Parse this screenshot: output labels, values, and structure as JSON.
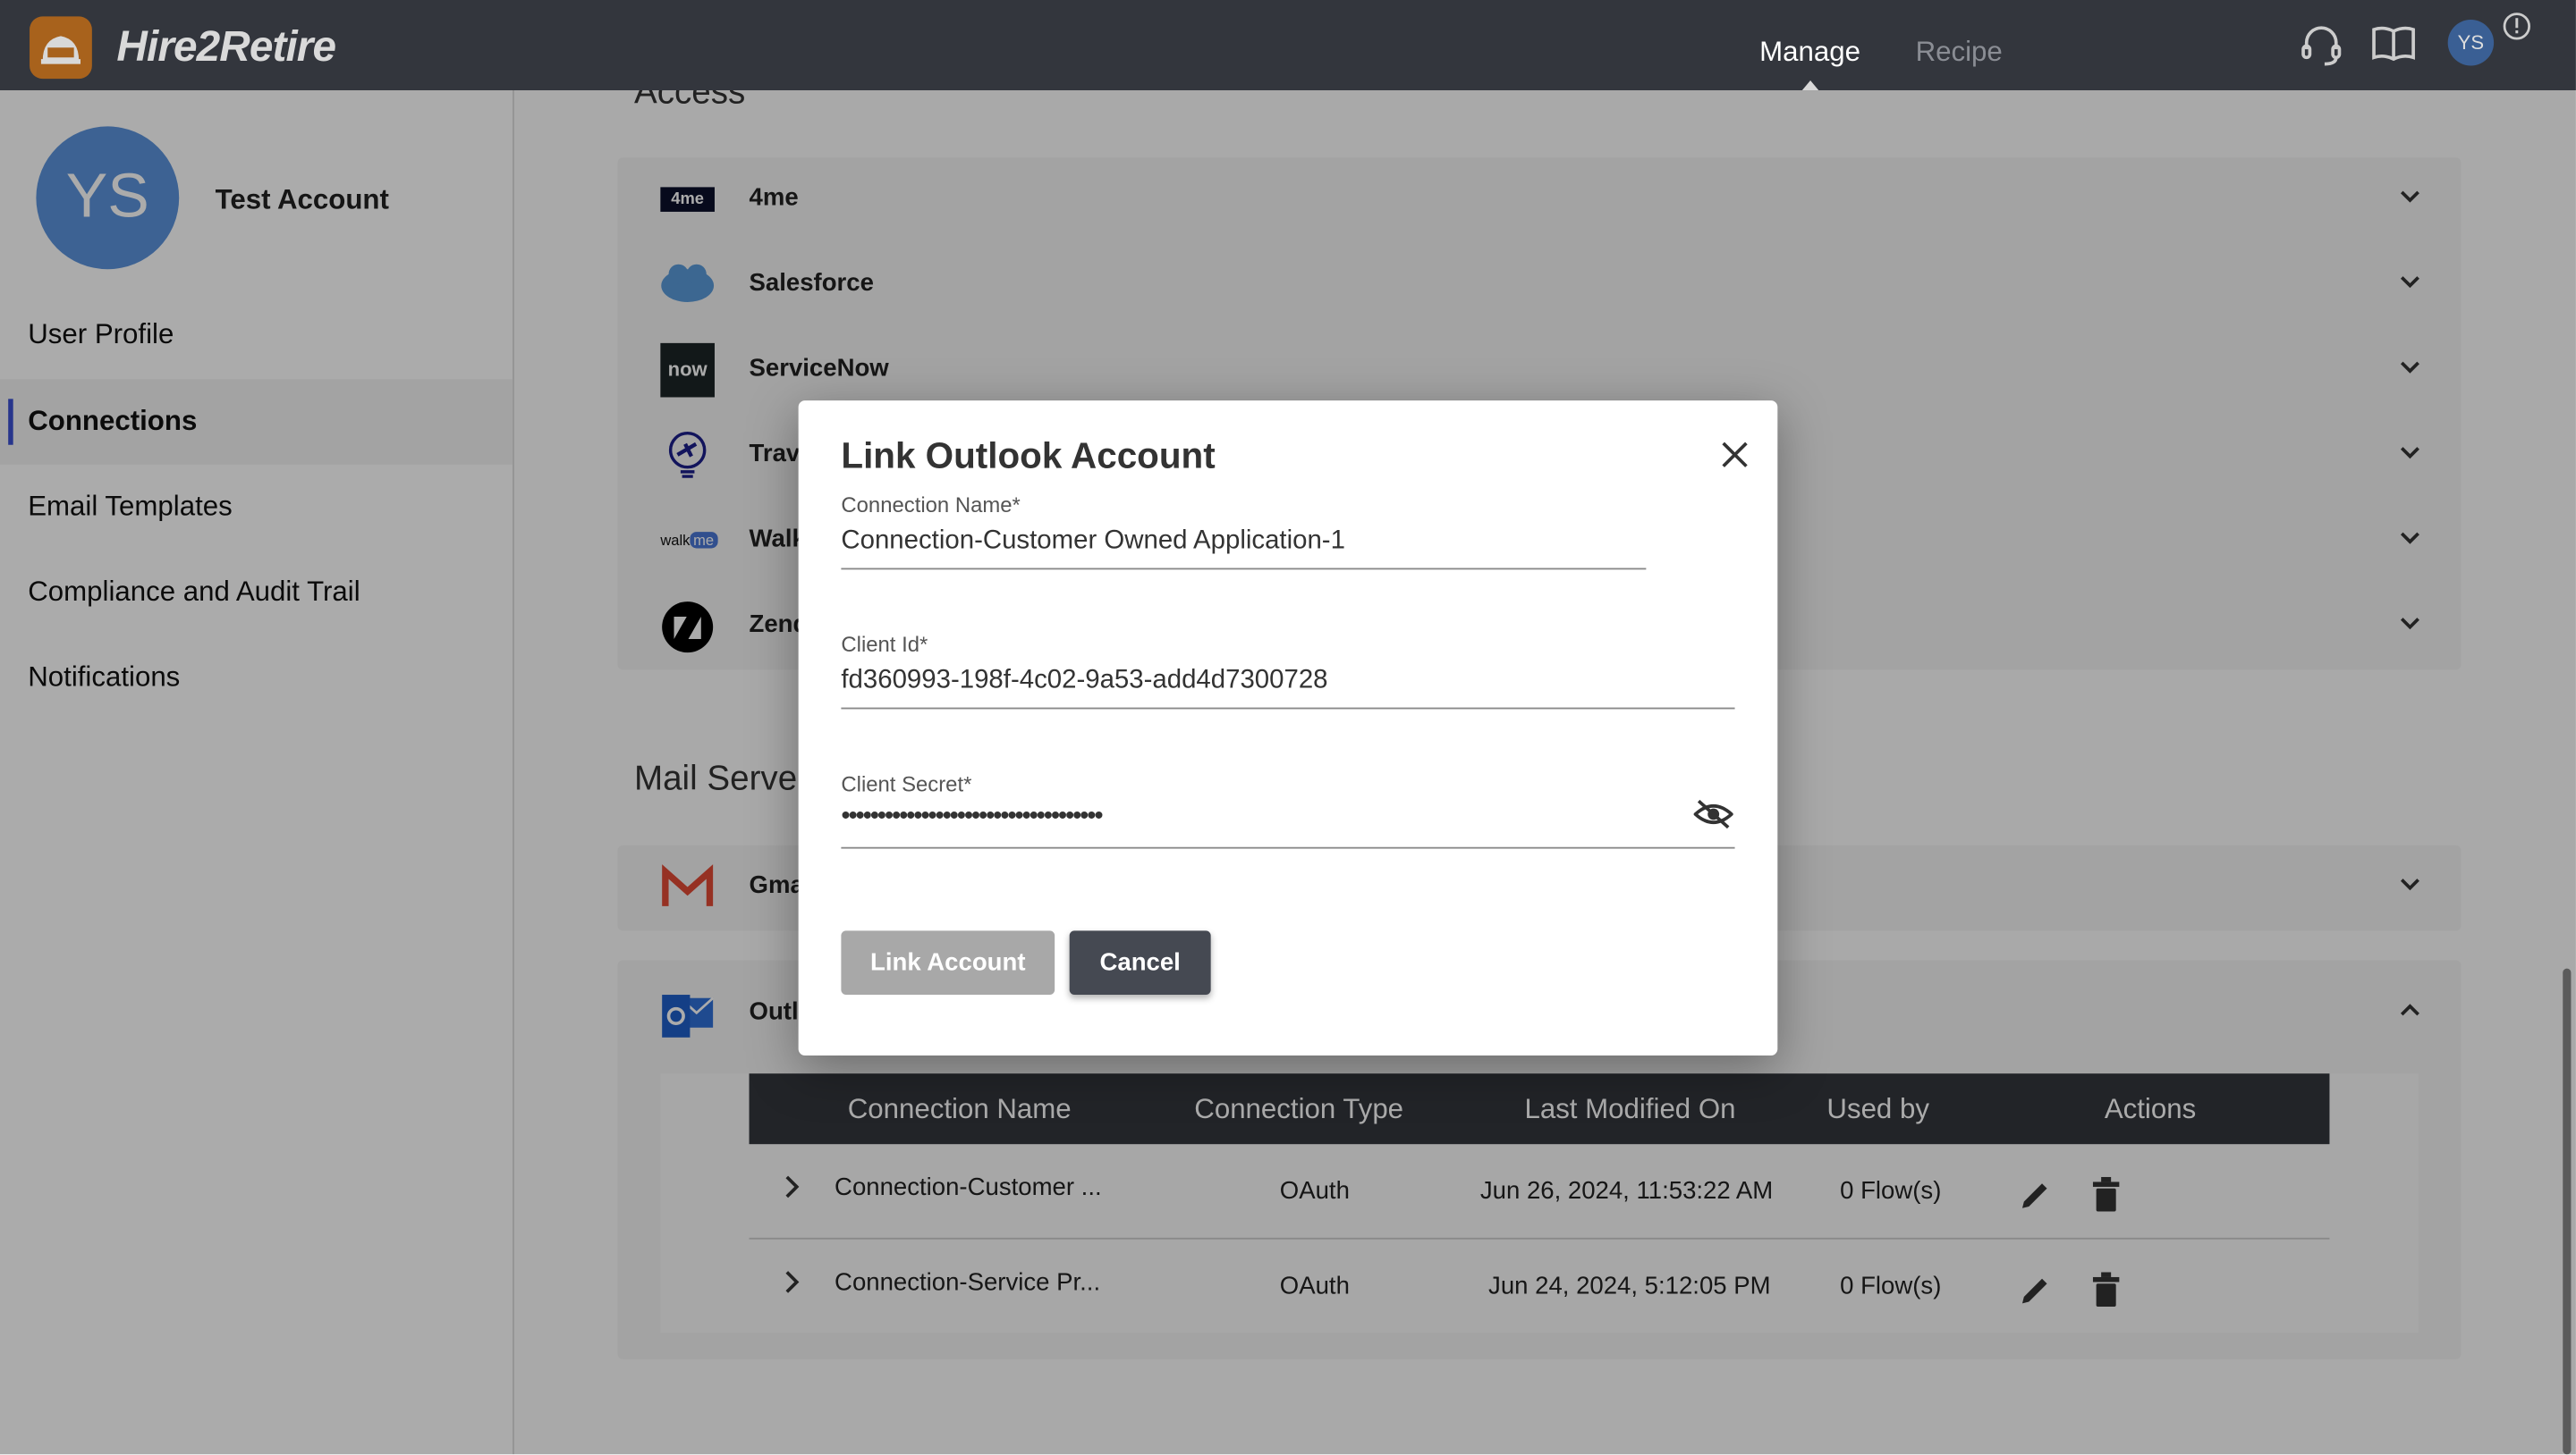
{
  "app": {
    "brand": "Hire2Retire",
    "nav": [
      {
        "label": "Manage",
        "active": true
      },
      {
        "label": "Recipe",
        "active": false
      }
    ],
    "user_initials": "YS"
  },
  "sidebar": {
    "account_initials": "YS",
    "account_name": "Test Account",
    "items": [
      {
        "label": "User Profile"
      },
      {
        "label": "Connections",
        "selected": true
      },
      {
        "label": "Email Templates"
      },
      {
        "label": "Compliance and Audit Trail"
      },
      {
        "label": "Notifications"
      }
    ]
  },
  "main": {
    "access_heading": "Access",
    "access_apps": [
      {
        "name": "4me",
        "logo": "4me"
      },
      {
        "name": "Salesforce",
        "logo": "salesforce"
      },
      {
        "name": "ServiceNow",
        "logo": "now"
      },
      {
        "name": "Trav",
        "logo": "travel-bulb"
      },
      {
        "name": "WalkMe",
        "logo": "walkme"
      },
      {
        "name": "Zendesk",
        "logo": "zendesk"
      }
    ],
    "mail_heading": "Mail Servers",
    "mail_apps": [
      {
        "name": "Gmail",
        "logo": "gmail",
        "expanded": false
      },
      {
        "name": "Outlook",
        "logo": "outlook",
        "expanded": true
      }
    ],
    "table": {
      "columns": [
        "Connection Name",
        "Connection Type",
        "Last Modified On",
        "Used by",
        "Actions"
      ],
      "rows": [
        {
          "name": "Connection-Customer ...",
          "type": "OAuth",
          "modified": "Jun 26, 2024, 11:53:22 AM",
          "used_by": "0 Flow(s)"
        },
        {
          "name": "Connection-Service Pr...",
          "type": "OAuth",
          "modified": "Jun 24, 2024, 5:12:05 PM",
          "used_by": "0 Flow(s)"
        }
      ]
    }
  },
  "modal": {
    "title": "Link Outlook Account",
    "connection_name": {
      "label": "Connection Name*",
      "value": "Connection-Customer Owned Application-1"
    },
    "client_id": {
      "label": "Client Id*",
      "value": "fd360993-198f-4c02-9a53-add4d7300728"
    },
    "client_secret": {
      "label": "Client Secret*",
      "value": "••••••••••••••••••••••••••••••••••••"
    },
    "link_label": "Link Account",
    "cancel_label": "Cancel"
  },
  "colors": {
    "topbar": "#33363d",
    "accent": "#3b4fd1",
    "avatar": "#3d6aa5",
    "link_disabled": "#a8a8a8",
    "cancel": "#454952"
  }
}
